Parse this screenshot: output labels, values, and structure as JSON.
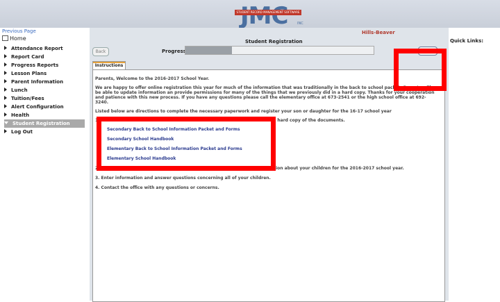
{
  "logo": {
    "text": "JMC",
    "tagline": "STUDENT RECORD MANAGEMENT SOFTWARE",
    "inc": "INC"
  },
  "sidebar": {
    "previous_page": "Previous Page",
    "home": "Home",
    "items": [
      {
        "label": "Attendance Report"
      },
      {
        "label": "Report Card"
      },
      {
        "label": "Progress Reports"
      },
      {
        "label": "Lesson Plans"
      },
      {
        "label": "Parent Information"
      },
      {
        "label": "Lunch"
      },
      {
        "label": "Tuition/Fees"
      },
      {
        "label": "Alert Configuration"
      },
      {
        "label": "Health"
      },
      {
        "label": "Student Registration",
        "active": true
      },
      {
        "label": "Log Out"
      }
    ]
  },
  "header": {
    "school": "Hills-Beaver",
    "title": "Student Registration",
    "back_label": "Back",
    "progress_label": "Progress:",
    "next_label": "Next",
    "quick_links": "Quick Links:"
  },
  "progress": {
    "steps": 8,
    "completed": 2
  },
  "tab": {
    "label": "Instructions"
  },
  "content": {
    "welcome": "Parents, Welcome to the 2016-2017 School Year.",
    "para1_l1": "We are happy to offer online registration this year for much of the information that was traditionally in the back to school packet. Parents will",
    "para1_l2": "be able to update information an provide permissions for many of the things that we previously did in a hard copy. Thanks for your cooperation",
    "para1_l3": "and patience with this new process. If you have any questions please call the elementary office at 673-2541 or the high school office at 692-",
    "para1_l4": "3240.",
    "listed": "Listed below are directions to complete the necessary paperwork and register your son or daughter for the 16-17 school year",
    "step1_num": "1.",
    "step1_tail": "rint a hard copy of the documents.",
    "links": [
      "Secondary Back to School Information Packet and Forms",
      "Secondary School Handbook",
      "Elementary Back to School Information Packet and Forms",
      "Elementary School Handbook"
    ],
    "step2_num": "2.",
    "step2_tail": "rmation about your children for the 2016-2017 school year.",
    "step3": "3.   Enter information and answer questions concerning all of your children.",
    "step4": "4.   Contact the office with any questions or concerns."
  },
  "colors": {
    "highlight": "#ff0000",
    "active_nav": "#a9a9a9",
    "link": "#2b3b8f"
  }
}
